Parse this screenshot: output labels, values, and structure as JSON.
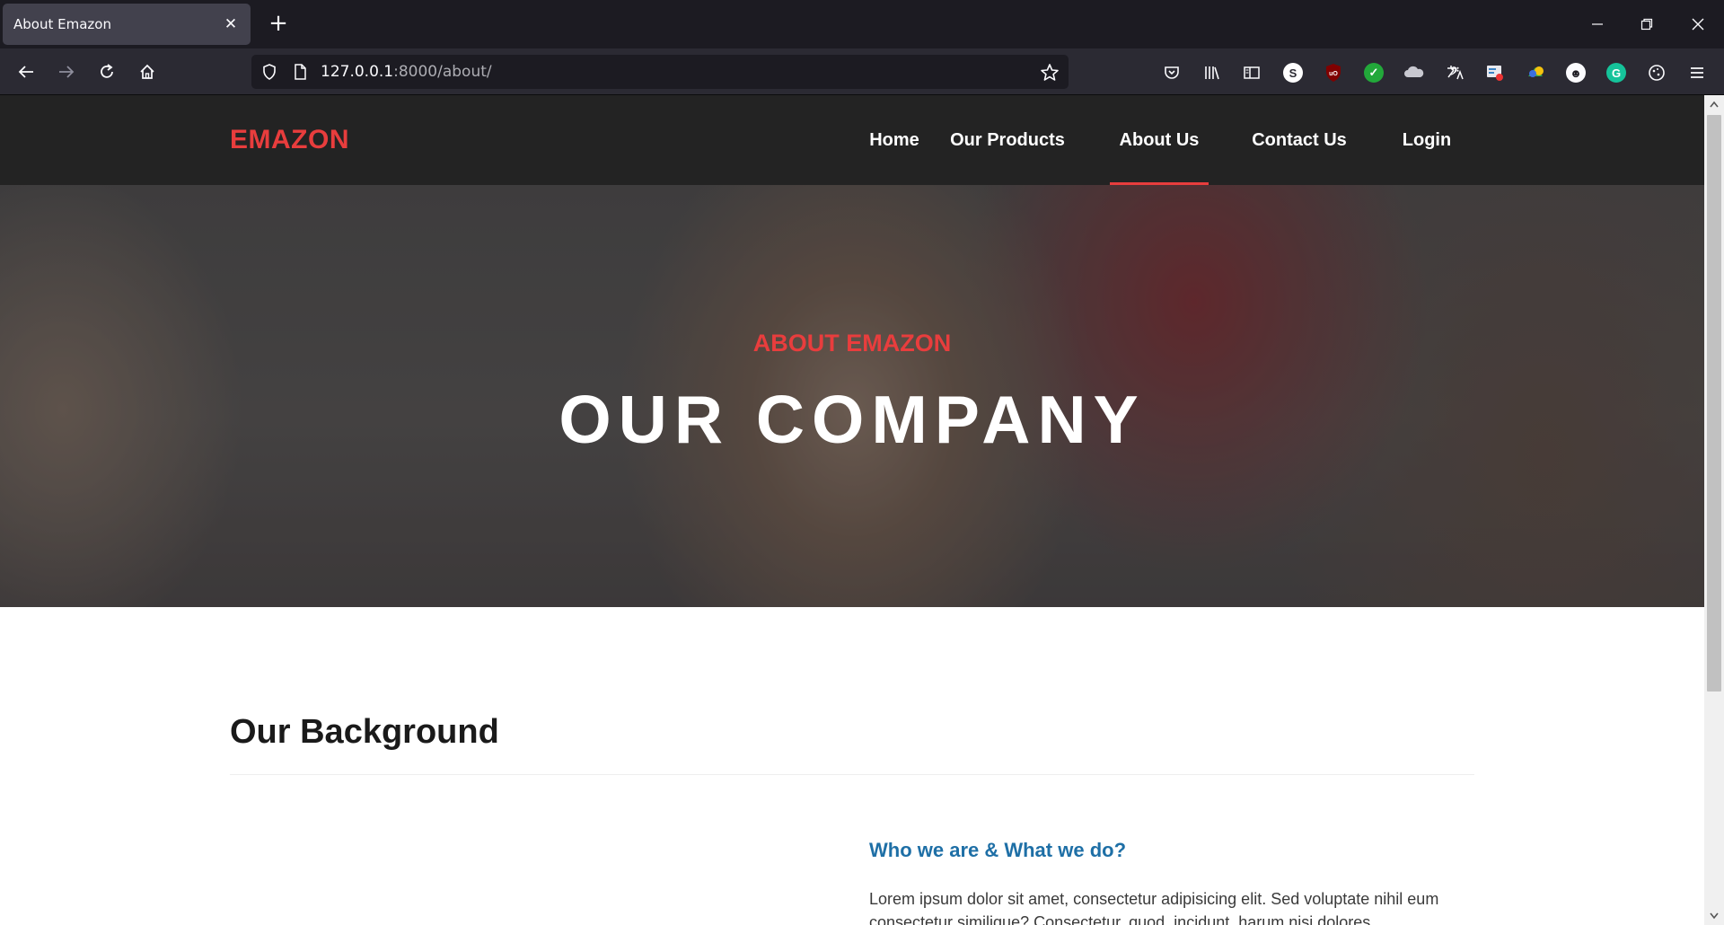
{
  "browser": {
    "tab_title": "About Emazon",
    "url_host": "127.0.0.1",
    "url_path": ":8000/about/"
  },
  "extensions": [
    "pocket-icon",
    "library-icon",
    "sidebar-icon",
    "skype-icon",
    "ublock-icon",
    "check-icon",
    "cloud-icon",
    "translate-icon",
    "image-icon",
    "color-icon",
    "face-icon",
    "grammarly-icon",
    "cookie-icon",
    "menu-icon"
  ],
  "site": {
    "logo": "EMAZON",
    "nav": [
      {
        "label": "Home"
      },
      {
        "label": "Our Products"
      },
      {
        "label": "About Us"
      },
      {
        "label": "Contact Us"
      },
      {
        "label": "Login"
      }
    ],
    "active_nav": "About Us",
    "accent_color": "#e83d3d"
  },
  "hero": {
    "subtitle": "ABOUT EMAZON",
    "title": "OUR COMPANY"
  },
  "background": {
    "title": "Our Background",
    "who_heading": "Who we are & What we do?",
    "paragraph": "Lorem ipsum dolor sit amet, consectetur adipisicing elit. Sed voluptate nihil eum consectetur similique? Consectetur, quod, incidunt, harum nisi dolores"
  }
}
